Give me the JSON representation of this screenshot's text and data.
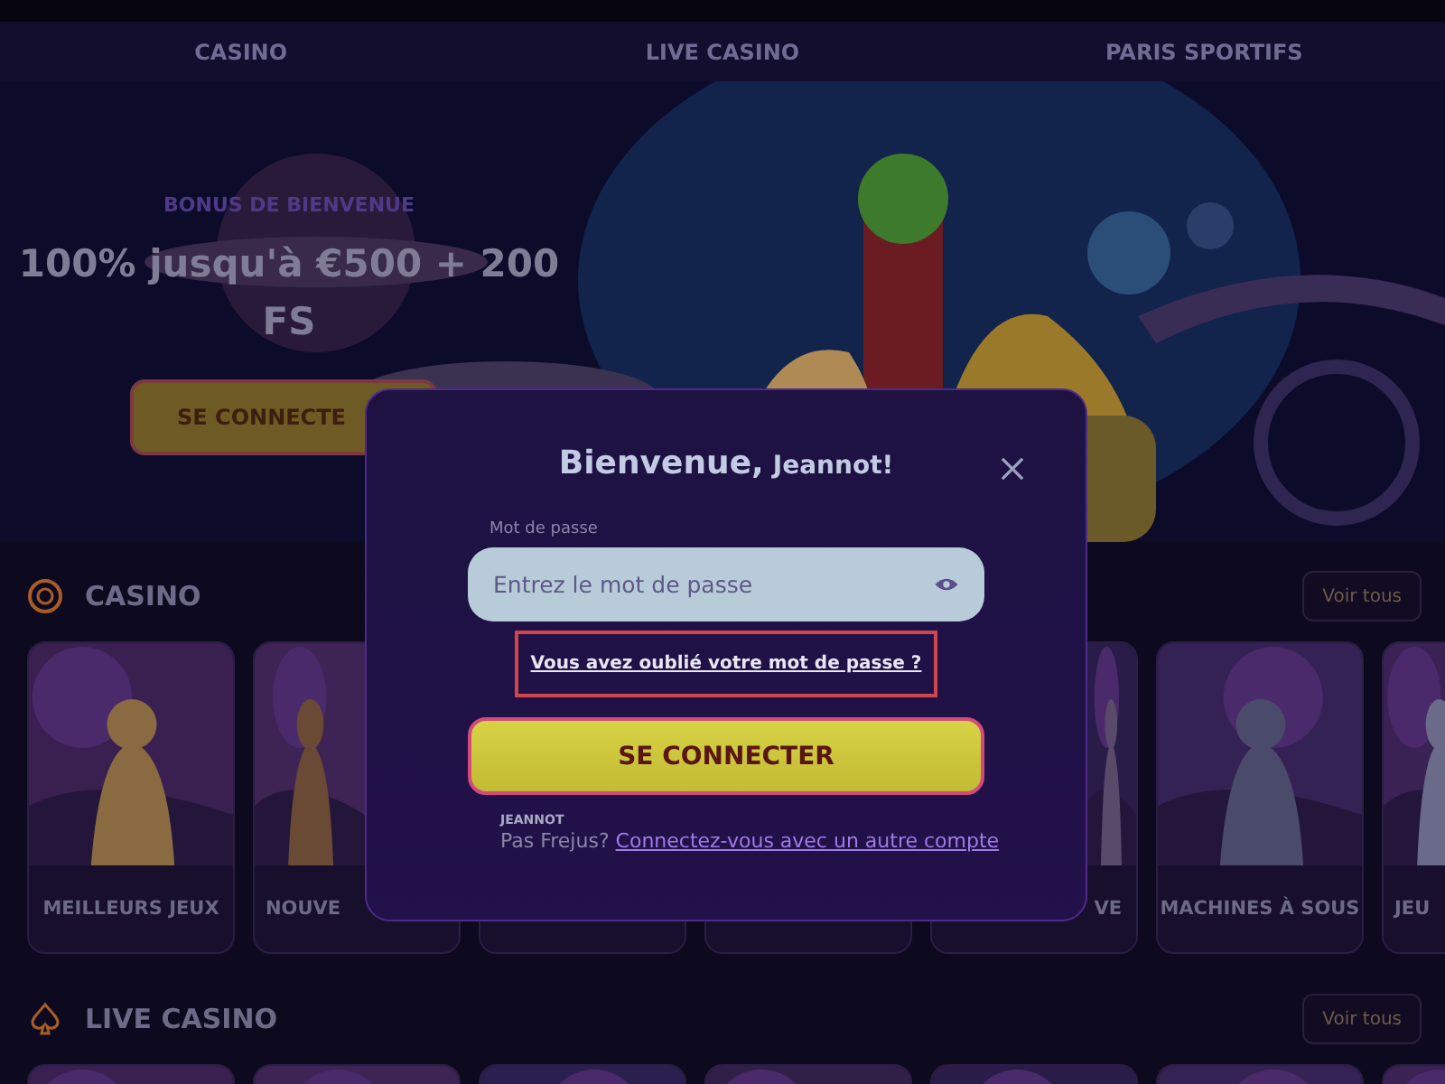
{
  "nav": {
    "items": [
      {
        "label": "CASINO"
      },
      {
        "label": "LIVE CASINO"
      },
      {
        "label": "PARIS SPORTIFS"
      }
    ]
  },
  "hero": {
    "kicker": "BONUS DE BIENVENUE",
    "headline": "100% jusqu'à €500 + 200 FS",
    "button": "SE CONNECTE"
  },
  "sections": [
    {
      "title": "CASINO",
      "action": "Voir tous",
      "cards": [
        {
          "kind": "game",
          "label": "MEILLEURS JEUX"
        },
        {
          "kind": "trailing",
          "label": "NOUVE"
        },
        {
          "kind": "covered"
        },
        {
          "kind": "covered"
        },
        {
          "kind": "leading",
          "label": "VE"
        },
        {
          "kind": "game",
          "label": "MACHINES À SOUS"
        },
        {
          "kind": "trailing",
          "label": "JEU"
        }
      ]
    },
    {
      "title": "LIVE CASINO",
      "action": "Voir tous",
      "cards": [
        {
          "kind": "game"
        },
        {
          "kind": "game"
        },
        {
          "kind": "game"
        },
        {
          "kind": "game"
        },
        {
          "kind": "game"
        },
        {
          "kind": "game"
        },
        {
          "kind": "game"
        }
      ]
    }
  ],
  "modal": {
    "title": "Bienvenue,",
    "name": "Jeannot!",
    "field_label": "Mot de passe",
    "placeholder": "Entrez le mot de passe",
    "forgot_link": {
      "label": "Vous avez oublié votre mot de passe ?",
      "highlighted": true
    },
    "button": "SE CONNECTER",
    "account": "JEANNOT",
    "switch_text": "Pas Frejus?",
    "switch_link": "Connectez-vous avec un autre compte"
  }
}
